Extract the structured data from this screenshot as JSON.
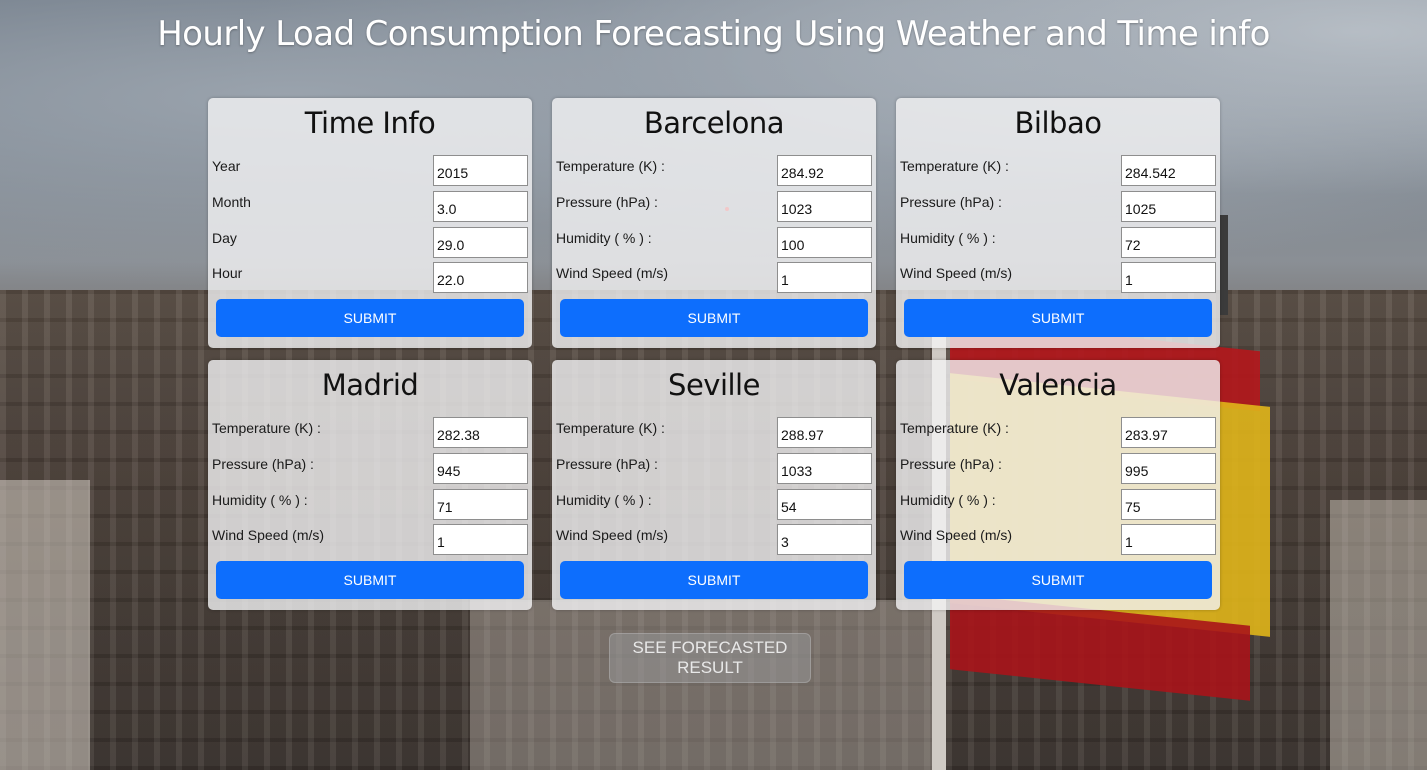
{
  "page_title": "Hourly Load Consumption Forecasting Using Weather and Time info",
  "cards": [
    {
      "title": "Time Info",
      "fields": [
        {
          "label": "Year",
          "value": "2015"
        },
        {
          "label": "Month",
          "value": "3.0"
        },
        {
          "label": "Day",
          "value": "29.0"
        },
        {
          "label": "Hour",
          "value": "22.0"
        }
      ],
      "submit_label": "SUBMIT"
    },
    {
      "title": "Barcelona",
      "fields": [
        {
          "label": "Temperature (K) :",
          "value": "284.92"
        },
        {
          "label": "Pressure (hPa) :",
          "value": "1023"
        },
        {
          "label": "Humidity ( % ) :",
          "value": "100"
        },
        {
          "label": "Wind Speed (m/s)",
          "value": "1"
        }
      ],
      "submit_label": "SUBMIT"
    },
    {
      "title": "Bilbao",
      "fields": [
        {
          "label": "Temperature (K) :",
          "value": "284.542"
        },
        {
          "label": "Pressure (hPa) :",
          "value": "1025"
        },
        {
          "label": "Humidity ( % ) :",
          "value": "72"
        },
        {
          "label": "Wind Speed (m/s)",
          "value": "1"
        }
      ],
      "submit_label": "SUBMIT"
    },
    {
      "title": "Madrid",
      "fields": [
        {
          "label": "Temperature (K) :",
          "value": "282.38"
        },
        {
          "label": "Pressure (hPa) :",
          "value": "945"
        },
        {
          "label": "Humidity ( % ) :",
          "value": "71"
        },
        {
          "label": "Wind Speed (m/s)",
          "value": "1"
        }
      ],
      "submit_label": "SUBMIT"
    },
    {
      "title": "Seville",
      "fields": [
        {
          "label": "Temperature (K) :",
          "value": "288.97"
        },
        {
          "label": "Pressure (hPa) :",
          "value": "1033"
        },
        {
          "label": "Humidity ( % ) :",
          "value": "54"
        },
        {
          "label": "Wind Speed (m/s)",
          "value": "3"
        }
      ],
      "submit_label": "SUBMIT"
    },
    {
      "title": "Valencia",
      "fields": [
        {
          "label": "Temperature (K) :",
          "value": "283.97"
        },
        {
          "label": "Pressure (hPa) :",
          "value": "995"
        },
        {
          "label": "Humidity ( % ) :",
          "value": "75"
        },
        {
          "label": "Wind Speed (m/s)",
          "value": "1"
        }
      ],
      "submit_label": "SUBMIT"
    }
  ],
  "forecast_button_label": "SEE FORECASTED RESULT",
  "colors": {
    "submit_button": "#0d6efd",
    "card_background": "#f2f2f4"
  }
}
